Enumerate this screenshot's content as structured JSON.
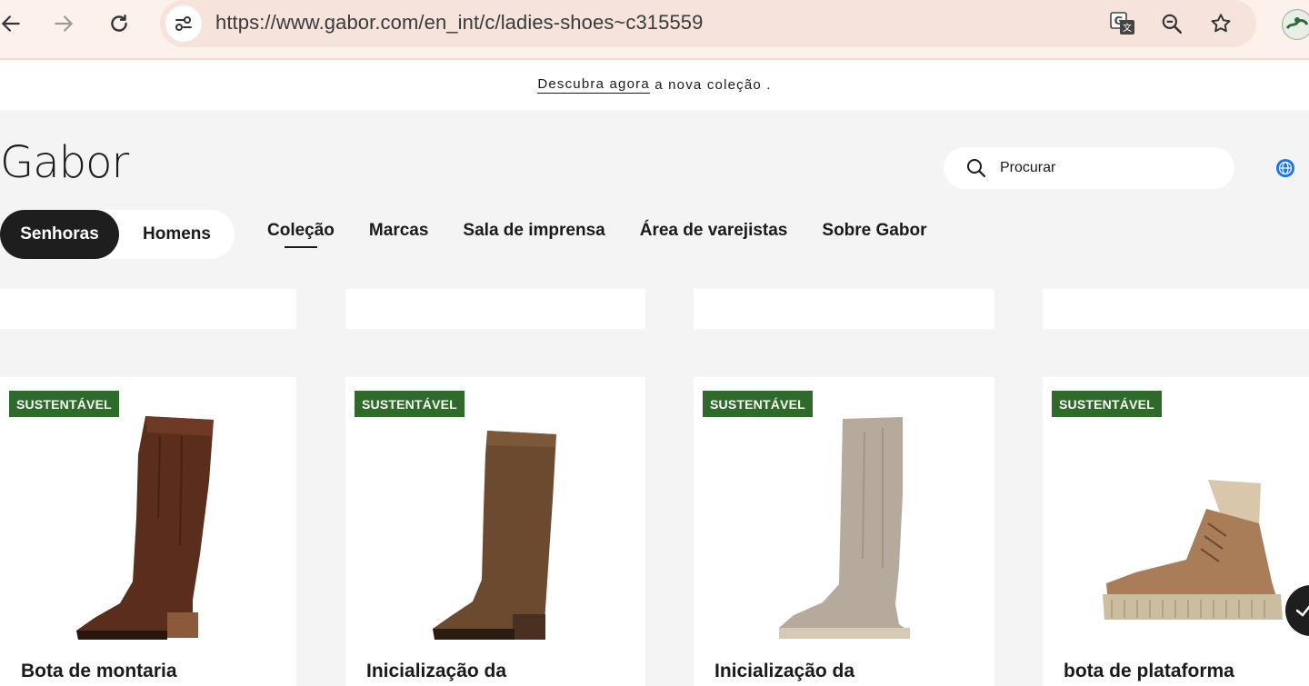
{
  "browser": {
    "url": "https://www.gabor.com/en_int/c/ladies-shoes~c315559"
  },
  "announcement": {
    "link_text": "Descubra agora",
    "rest_text": " a nova coleção ."
  },
  "header": {
    "logo": "Gabor",
    "search_placeholder": "Procurar",
    "gender_tabs": [
      {
        "label": "Senhoras",
        "active": true
      },
      {
        "label": "Homens",
        "active": false
      }
    ],
    "nav_items": [
      {
        "label": "Coleção",
        "current": true
      },
      {
        "label": "Marcas",
        "current": false
      },
      {
        "label": "Sala de imprensa",
        "current": false
      },
      {
        "label": "Área de varejistas",
        "current": false
      },
      {
        "label": "Sobre Gabor",
        "current": false
      }
    ]
  },
  "products": [
    {
      "badge": "SUSTENTÁVEL",
      "title": "Bota de montaria",
      "shoe_color": "#5a2d1c"
    },
    {
      "badge": "SUSTENTÁVEL",
      "title": "Inicialização da",
      "shoe_color": "#6b4a30"
    },
    {
      "badge": "SUSTENTÁVEL",
      "title": "Inicialização da",
      "shoe_color": "#b5aa9c"
    },
    {
      "badge": "SUSTENTÁVEL",
      "title": "bota de plataforma",
      "shoe_color": "#a97d57"
    }
  ],
  "colors": {
    "badge_green": "#2e6a2a",
    "active_tab": "#1e1e1e",
    "globe_blue": "#1a73e8"
  }
}
